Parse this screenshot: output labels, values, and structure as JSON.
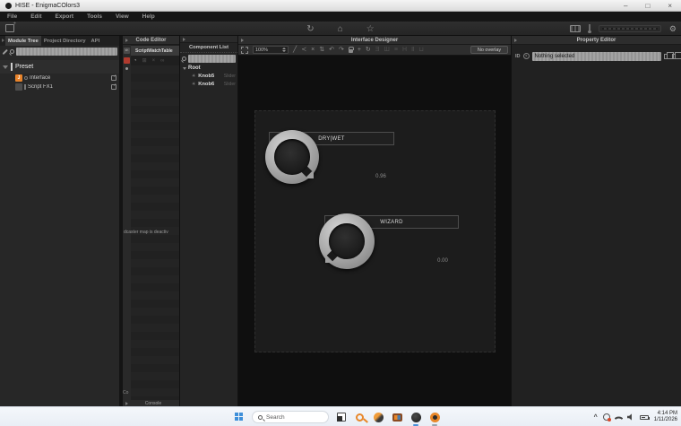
{
  "window": {
    "title": "HISE - EnigmaCOlors3",
    "minimize": "–",
    "maximize": "□",
    "close": "×"
  },
  "menu_bar": {
    "items": [
      "File",
      "Edit",
      "Export",
      "Tools",
      "View",
      "Help"
    ]
  },
  "toolbar": {
    "icons": {
      "refresh": "↻",
      "home": "⌂",
      "star": "☆",
      "settings": "⚙"
    }
  },
  "module_tree": {
    "tabs": [
      "Module Tree",
      "Project Directory",
      "API"
    ],
    "preset_label": "Preset",
    "items": [
      {
        "label": "Interface",
        "icon_letter": "J"
      },
      {
        "label": "Script FX1",
        "icon_letter": ""
      }
    ]
  },
  "code_editor": {
    "title": "Code Editor",
    "strip_icon": "sh",
    "tab_label": "ScriptWatchTable",
    "watch_icons": {
      "clock": "◔",
      "grid": "⊞",
      "close": "×",
      "link": "∞"
    },
    "status_message": "dcaster map is deactiv",
    "console_partial": "Co",
    "console_label": "Console"
  },
  "component_list": {
    "title": "Component List",
    "root_label": "Root",
    "items": [
      {
        "name": "Knob5",
        "type": "Slider"
      },
      {
        "name": "Knob6",
        "type": "Slider"
      }
    ]
  },
  "interface_designer": {
    "title": "Interface Designer",
    "zoom_level": "100%",
    "overlay_selector": "No overlay",
    "tool_icons": {
      "pencil": "╱",
      "nodes": "≺",
      "delete": "×",
      "move": "⇅",
      "undo": "↶",
      "redo": "↷",
      "add": "+",
      "rotate": "↻"
    },
    "align_icons": [
      "Ǝ",
      "Ш",
      "≡",
      "H",
      "Ⅱ",
      "⊔"
    ],
    "knobs": [
      {
        "label": "DRY|WET",
        "value": "0.96"
      },
      {
        "label": "WIZARD",
        "value": "0.00"
      }
    ]
  },
  "property_editor": {
    "title": "Property Editor",
    "id_label": "ID",
    "help_label": "?",
    "selection_status": "Nothing selected"
  },
  "taskbar": {
    "search_placeholder": "Search",
    "clock": {
      "time": "4:14 PM",
      "date": "1/11/2026"
    }
  },
  "colors": {
    "accent_orange": "#e8832a",
    "active_indicator_blue": "#4a90d9",
    "error_red": "#b03a2e"
  }
}
